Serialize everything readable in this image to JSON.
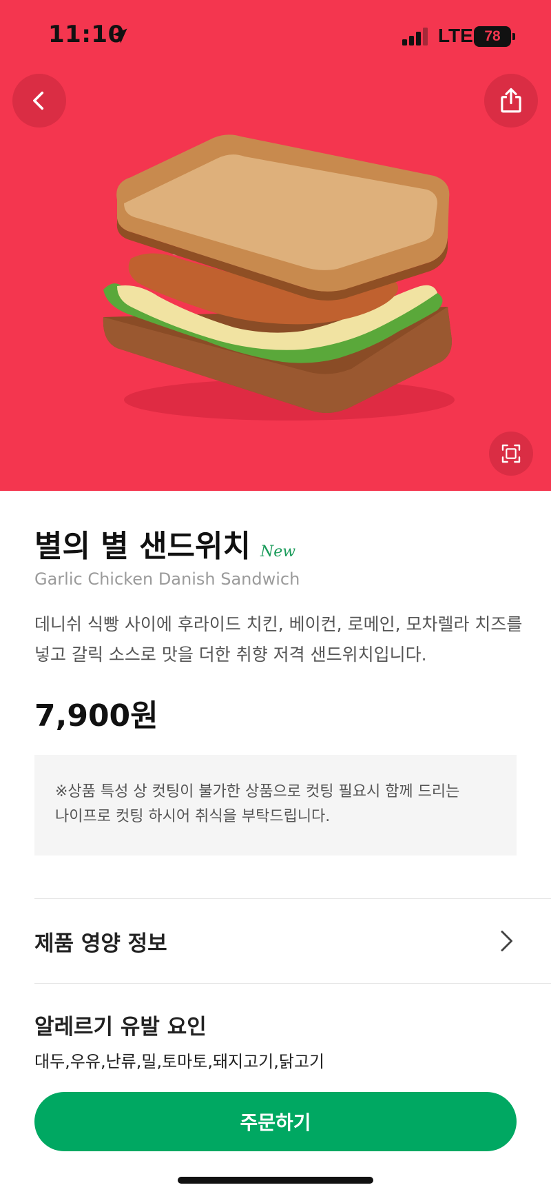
{
  "status_bar": {
    "time": "11:10",
    "network": "LTE",
    "battery": "78"
  },
  "product": {
    "name": "별의 별 샌드위치",
    "badge": "New",
    "english_name": "Garlic Chicken Danish Sandwich",
    "description": "데니쉬 식빵 사이에 후라이드 치킨, 베이컨, 로메인, 모차렐라 치즈를 넣고 갈릭 소스로 맛을 더한 취향 저격 샌드위치입니다.",
    "price": "7,900원",
    "notice": "※상품 특성 상 컷팅이 불가한 상품으로 컷팅 필요시 함께 드리는 나이프로 컷팅 하시어 취식을 부탁드립니다."
  },
  "sections": {
    "nutrition_label": "제품 영양 정보",
    "allergy_title": "알레르기 유발 요인",
    "allergy_list": "대두,우유,난류,밀,토마토,돼지고기,닭고기"
  },
  "actions": {
    "order_label": "주문하기"
  },
  "colors": {
    "hero_background": "#f4364f",
    "brand_green": "#00a862",
    "badge_green": "#1a9b5a"
  },
  "icons": {
    "back": "chevron-left-icon",
    "share": "share-icon",
    "zoom": "fullscreen-icon",
    "nutrition_chevron": "chevron-right-icon"
  }
}
